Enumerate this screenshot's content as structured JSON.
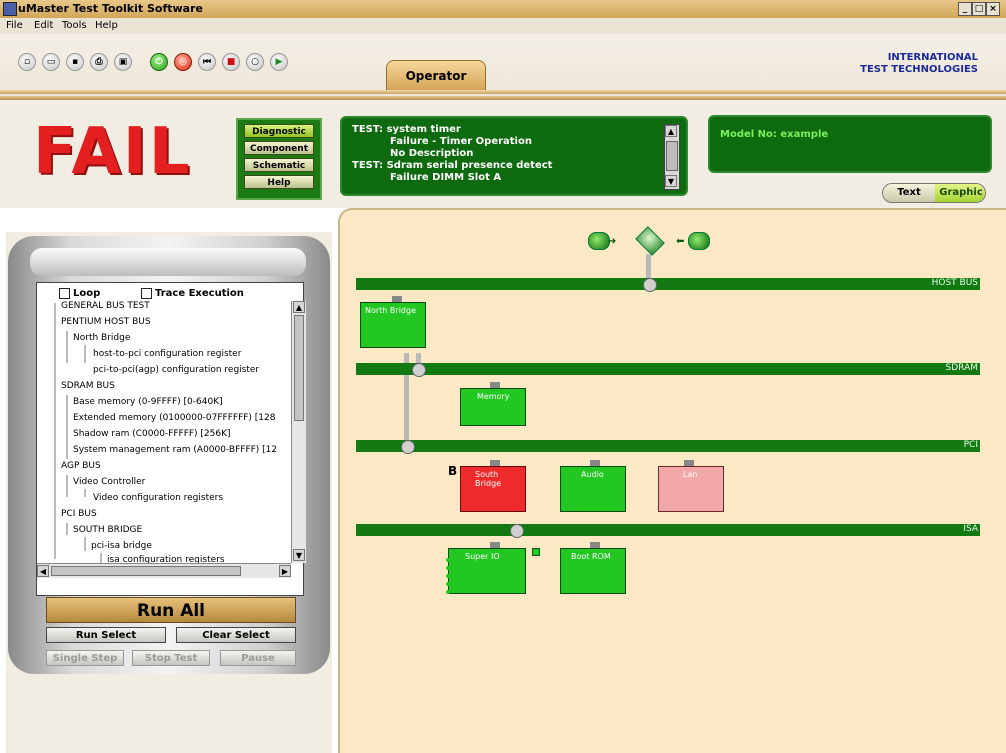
{
  "app": {
    "title": "uMaster Test Toolkit Software"
  },
  "menu": [
    {
      "label": "File"
    },
    {
      "label": "Edit"
    },
    {
      "label": "Tools"
    },
    {
      "label": "Help"
    }
  ],
  "toolbar": {
    "tab_label": "Operator",
    "logo_line1": "INTERNATIONAL",
    "logo_line2": "TEST TECHNOLOGIES"
  },
  "status": {
    "result": "FAIL",
    "modes": [
      "Diagnostic",
      "Component",
      "Schematic",
      "Help"
    ],
    "messages": [
      "TEST: system timer",
      "Failure - Timer Operation",
      "No Description",
      "TEST: Sdram serial presence detect",
      "Failure DIMM Slot A"
    ],
    "model_text": "Model No: example",
    "view_text": "Text",
    "view_graphic": "Graphic"
  },
  "left_panel": {
    "loop_label": "Loop",
    "trace_label": "Trace Execution",
    "tree_items": [
      "GENERAL BUS TEST",
      "PENTIUM HOST BUS",
      "North Bridge",
      "host-to-pci configuration register",
      "pci-to-pci(agp) configuration register",
      "SDRAM BUS",
      "Base memory (0-9FFFF) [0-640K]",
      "Extended memory (0100000-07FFFFFF) [128",
      "Shadow ram (C0000-FFFFF) [256K]",
      "System management ram (A0000-BFFFF) [12",
      "AGP BUS",
      "Video Controller",
      "Video configuration registers",
      "PCI BUS",
      "SOUTH BRIDGE",
      "pci-isa bridge",
      "isa configuration registers"
    ],
    "run_all": "Run All",
    "run_select": "Run Select",
    "clear_select": "Clear Select",
    "single_step": "Single Step",
    "stop_test": "Stop Test",
    "pause": "Pause"
  },
  "diagram": {
    "buses": [
      {
        "label": "HOST BUS"
      },
      {
        "label": "SDRAM"
      },
      {
        "label": "PCI"
      },
      {
        "label": "ISA"
      }
    ],
    "components": [
      {
        "label": "North Bridge",
        "status": "pass"
      },
      {
        "label": "Memory",
        "status": "pass"
      },
      {
        "label": "South Bridge",
        "status": "fail"
      },
      {
        "label": "Audio",
        "status": "pass"
      },
      {
        "label": "Lan",
        "status": "warn"
      },
      {
        "label": "Super IO",
        "status": "pass"
      },
      {
        "label": "Boot ROM",
        "status": "pass"
      }
    ],
    "marker_letter": "B"
  },
  "colors": {
    "fail_red": "#e41f1f",
    "bus_green": "#137a13",
    "pass_green": "#22c722",
    "fail_red_box": "#ee2a2a",
    "warn_pink": "#f2a8a8",
    "canvas_bg": "#fbe9c5"
  }
}
